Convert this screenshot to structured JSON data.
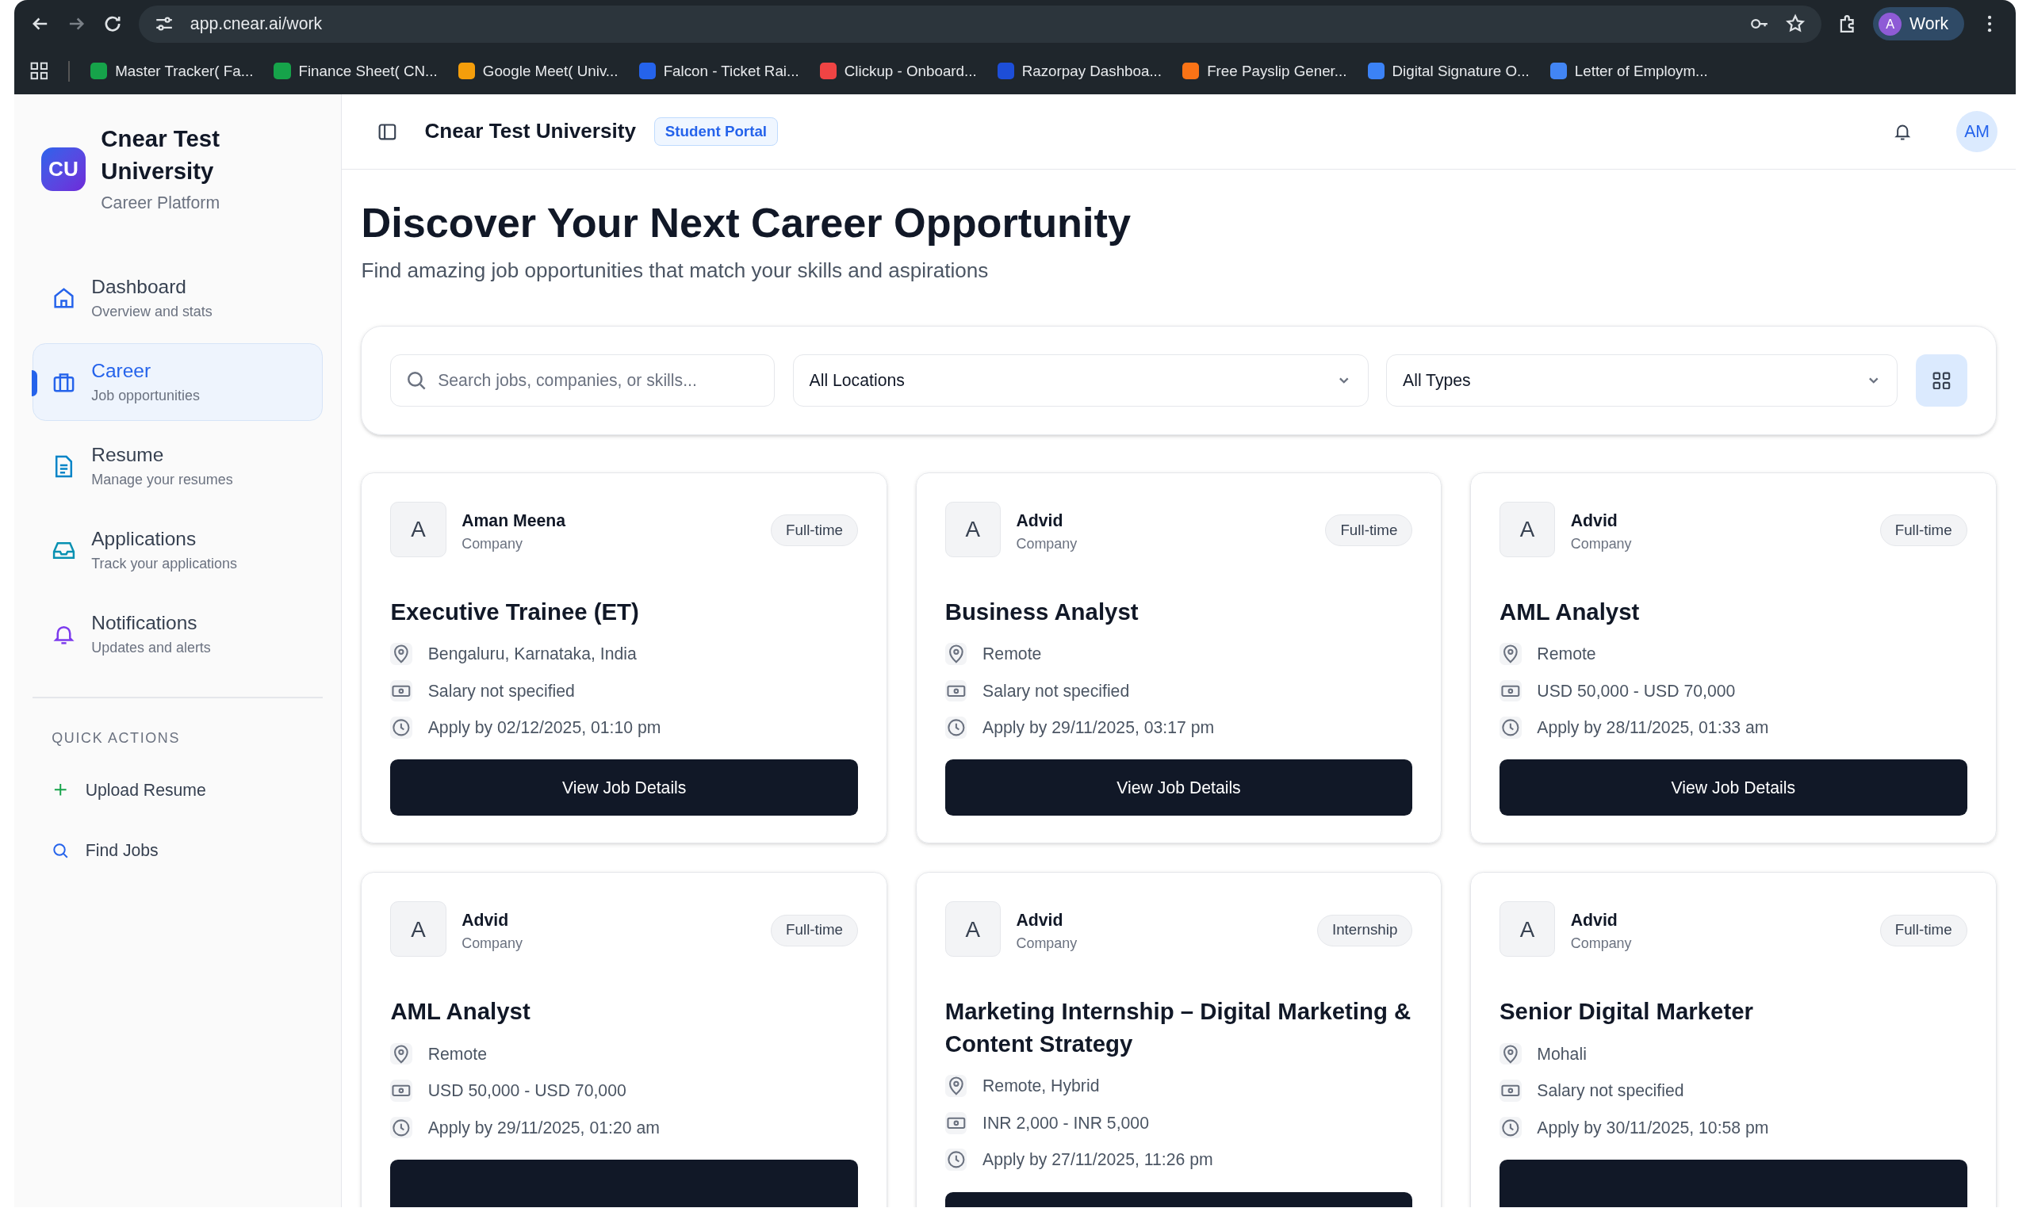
{
  "browser": {
    "url": "app.cnear.ai/work",
    "profile_initial": "A",
    "profile_name": "Work",
    "bookmarks": [
      {
        "label": "Master Tracker( Fa...",
        "color": "#16a34a"
      },
      {
        "label": "Finance Sheet( CN...",
        "color": "#16a34a"
      },
      {
        "label": "Google Meet( Univ...",
        "color": "#f59e0b"
      },
      {
        "label": "Falcon - Ticket Rai...",
        "color": "#2563eb"
      },
      {
        "label": "Clickup - Onboard...",
        "color": "#ef4444"
      },
      {
        "label": "Razorpay Dashboa...",
        "color": "#1d4ed8"
      },
      {
        "label": "Free Payslip Gener...",
        "color": "#f97316"
      },
      {
        "label": "Digital Signature O...",
        "color": "#3b82f6"
      },
      {
        "label": "Letter of Employm...",
        "color": "#4285f4"
      }
    ]
  },
  "sidebar": {
    "logo": "CU",
    "title": "Cnear Test University",
    "subtitle": "Career Platform",
    "items": [
      {
        "kind": "home",
        "label": "Dashboard",
        "description": "Overview and stats",
        "selected": false
      },
      {
        "kind": "briefcase",
        "label": "Career",
        "description": "Job opportunities",
        "selected": true
      },
      {
        "kind": "document",
        "label": "Resume",
        "description": "Manage your resumes",
        "selected": false
      },
      {
        "kind": "inbox",
        "label": "Applications",
        "description": "Track your applications",
        "selected": false
      },
      {
        "kind": "bell",
        "label": "Notifications",
        "description": "Updates and alerts",
        "selected": false
      }
    ],
    "quick_actions_heading": "QUICK ACTIONS",
    "quick_actions": [
      {
        "kind": "plus",
        "label": "Upload Resume"
      },
      {
        "kind": "search",
        "label": "Find Jobs"
      }
    ]
  },
  "header": {
    "title": "Cnear Test University",
    "badge": "Student Portal",
    "avatar": "AM"
  },
  "page": {
    "title": "Discover Your Next Career Opportunity",
    "subtitle": "Find amazing job opportunities that match your skills and aspirations"
  },
  "filters": {
    "search": {
      "placeholder": "Search jobs, companies, or skills..."
    },
    "location": "All Locations",
    "type": "All Types"
  },
  "jobs": [
    {
      "initial": "A",
      "company": "Aman Meena",
      "company_label": "Company",
      "type": "Full-time",
      "title": "Executive Trainee (ET)",
      "location": "Bengaluru, Karnataka, India",
      "salary": "Salary not specified",
      "deadline": "Apply by 02/12/2025, 01:10 pm",
      "button": "View Job Details"
    },
    {
      "initial": "A",
      "company": "Advid",
      "company_label": "Company",
      "type": "Full-time",
      "title": "Business Analyst",
      "location": "Remote",
      "salary": "Salary not specified",
      "deadline": "Apply by 29/11/2025, 03:17 pm",
      "button": "View Job Details"
    },
    {
      "initial": "A",
      "company": "Advid",
      "company_label": "Company",
      "type": "Full-time",
      "title": "AML Analyst",
      "location": "Remote",
      "salary": "USD 50,000 - USD 70,000",
      "deadline": "Apply by 28/11/2025, 01:33 am",
      "button": "View Job Details"
    },
    {
      "initial": "A",
      "company": "Advid",
      "company_label": "Company",
      "type": "Full-time",
      "title": "AML Analyst",
      "location": "Remote",
      "salary": "USD 50,000 - USD 70,000",
      "deadline": "Apply by 29/11/2025, 01:20 am"
    },
    {
      "initial": "A",
      "company": "Advid",
      "company_label": "Company",
      "type": "Internship",
      "title": "Marketing Internship – Digital Marketing & Content Strategy",
      "location": "Remote, Hybrid",
      "salary": "INR 2,000 - INR 5,000",
      "deadline": "Apply by 27/11/2025, 11:26 pm"
    },
    {
      "initial": "A",
      "company": "Advid",
      "company_label": "Company",
      "type": "Full-time",
      "title": "Senior Digital Marketer",
      "location": "Mohali",
      "salary": "Salary not specified",
      "deadline": "Apply by 30/11/2025, 10:58 pm"
    }
  ]
}
